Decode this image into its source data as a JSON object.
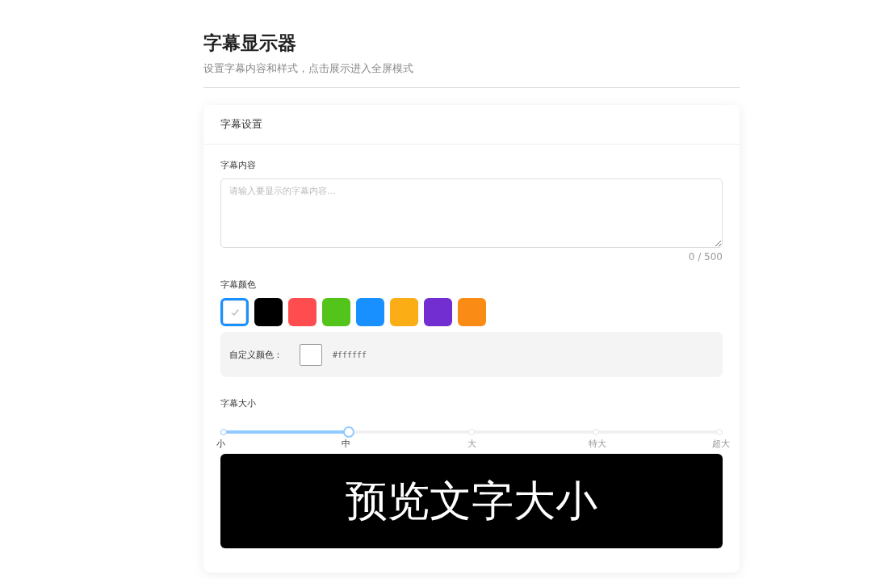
{
  "header": {
    "title": "字幕显示器",
    "subtitle": "设置字幕内容和样式，点击展示进入全屏模式"
  },
  "card": {
    "title": "字幕设置",
    "content": {
      "label": "字幕内容",
      "placeholder": "请输入要显示的字幕内容...",
      "counter": "0 / 500"
    },
    "color": {
      "label": "字幕颜色",
      "swatches": [
        {
          "color": "#ffffff",
          "selected": true
        },
        {
          "color": "#000000",
          "selected": false
        },
        {
          "color": "#ff4d4f",
          "selected": false
        },
        {
          "color": "#52c41a",
          "selected": false
        },
        {
          "color": "#1890ff",
          "selected": false
        },
        {
          "color": "#faad14",
          "selected": false
        },
        {
          "color": "#722ed1",
          "selected": false
        },
        {
          "color": "#fa8c16",
          "selected": false
        }
      ],
      "custom_label": "自定义颜色：",
      "custom_value": "#ffffff"
    },
    "size": {
      "label": "字幕大小",
      "level": 0.25,
      "marks": [
        {
          "label": "小",
          "reached": true
        },
        {
          "label": "中",
          "reached": true
        },
        {
          "label": "大",
          "reached": false
        },
        {
          "label": "特大",
          "reached": false
        },
        {
          "label": "超大",
          "reached": false
        }
      ]
    },
    "preview": {
      "text": "预览文字大小"
    }
  }
}
